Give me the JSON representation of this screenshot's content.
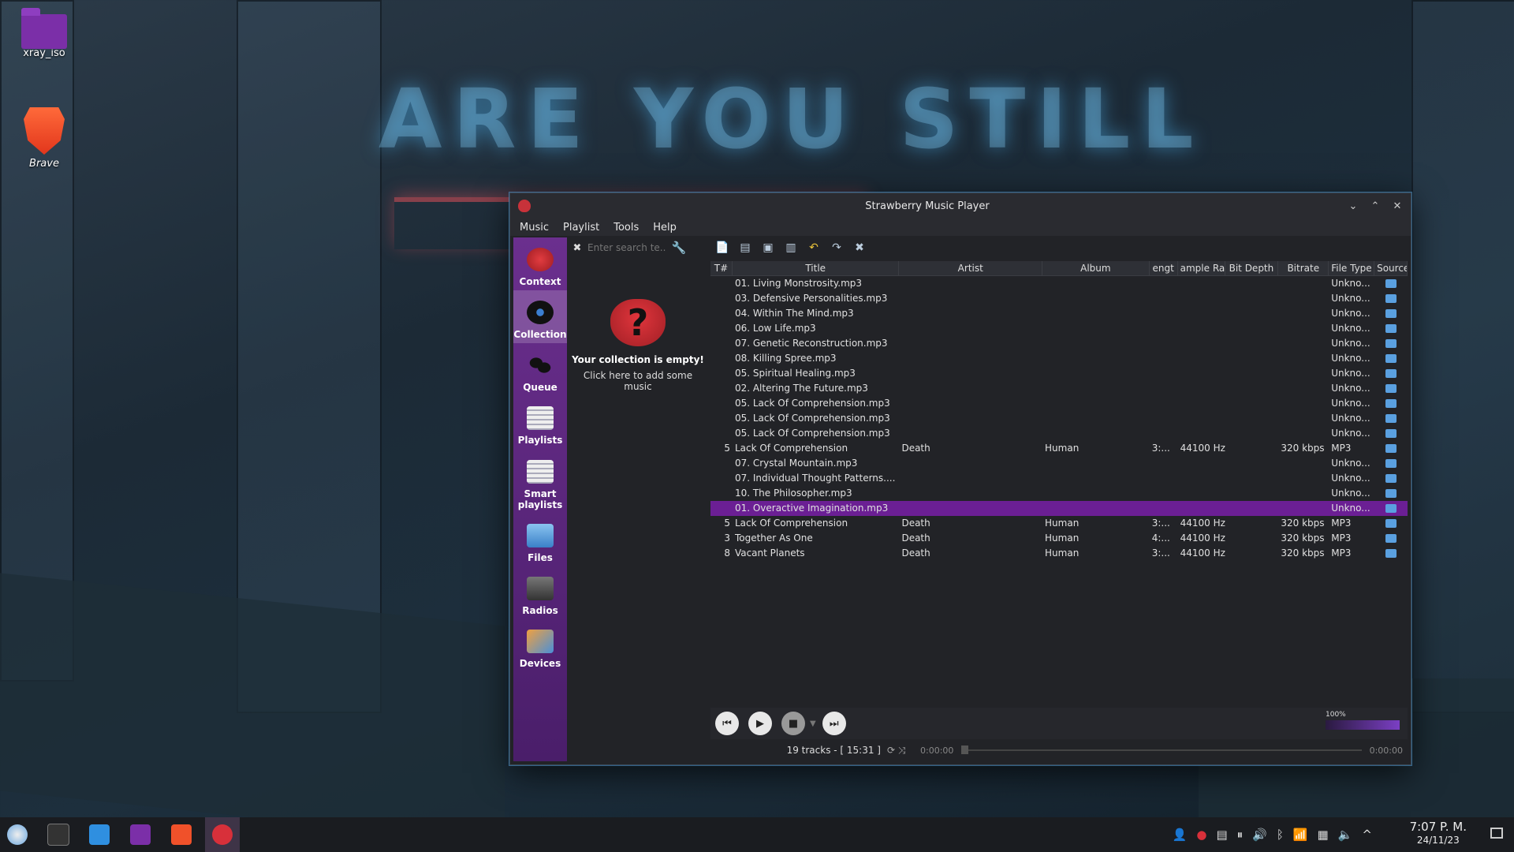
{
  "desktop": {
    "icons": [
      {
        "label": "xray_iso"
      },
      {
        "label": "Brave"
      }
    ],
    "wallpaper_text": "ARE YOU STILL"
  },
  "window": {
    "title": "Strawberry Music Player",
    "menu": [
      "Music",
      "Playlist",
      "Tools",
      "Help"
    ],
    "sidebar": [
      {
        "label": "Context",
        "icon": "strawberry-icon"
      },
      {
        "label": "Collection",
        "icon": "vinyl-icon",
        "active": true
      },
      {
        "label": "Queue",
        "icon": "footprints-icon"
      },
      {
        "label": "Playlists",
        "icon": "playlist-icon"
      },
      {
        "label": "Smart playlists",
        "icon": "smart-playlist-icon"
      },
      {
        "label": "Files",
        "icon": "files-icon"
      },
      {
        "label": "Radios",
        "icon": "radio-icon"
      },
      {
        "label": "Devices",
        "icon": "devices-icon"
      }
    ],
    "collection": {
      "search_placeholder": "Enter search te...",
      "empty_title": "Your collection is empty!",
      "empty_sub": "Click here to add some music"
    },
    "playlist": {
      "columns": [
        "T#",
        "Title",
        "Artist",
        "Album",
        "engt",
        "ample Rat",
        "Bit Depth",
        "Bitrate",
        "File Type",
        "Source"
      ],
      "rows": [
        {
          "tn": "",
          "title": "01. Living Monstrosity.mp3",
          "artist": "",
          "album": "",
          "length": "",
          "rate": "",
          "depth": "",
          "bitrate": "",
          "type": "Unkno..."
        },
        {
          "tn": "",
          "title": "03. Defensive Personalities.mp3",
          "artist": "",
          "album": "",
          "length": "",
          "rate": "",
          "depth": "",
          "bitrate": "",
          "type": "Unkno..."
        },
        {
          "tn": "",
          "title": "04. Within The Mind.mp3",
          "artist": "",
          "album": "",
          "length": "",
          "rate": "",
          "depth": "",
          "bitrate": "",
          "type": "Unkno..."
        },
        {
          "tn": "",
          "title": "06. Low Life.mp3",
          "artist": "",
          "album": "",
          "length": "",
          "rate": "",
          "depth": "",
          "bitrate": "",
          "type": "Unkno..."
        },
        {
          "tn": "",
          "title": "07. Genetic Reconstruction.mp3",
          "artist": "",
          "album": "",
          "length": "",
          "rate": "",
          "depth": "",
          "bitrate": "",
          "type": "Unkno..."
        },
        {
          "tn": "",
          "title": "08. Killing Spree.mp3",
          "artist": "",
          "album": "",
          "length": "",
          "rate": "",
          "depth": "",
          "bitrate": "",
          "type": "Unkno..."
        },
        {
          "tn": "",
          "title": "05. Spiritual Healing.mp3",
          "artist": "",
          "album": "",
          "length": "",
          "rate": "",
          "depth": "",
          "bitrate": "",
          "type": "Unkno..."
        },
        {
          "tn": "",
          "title": "02. Altering The Future.mp3",
          "artist": "",
          "album": "",
          "length": "",
          "rate": "",
          "depth": "",
          "bitrate": "",
          "type": "Unkno..."
        },
        {
          "tn": "",
          "title": "05. Lack Of Comprehension.mp3",
          "artist": "",
          "album": "",
          "length": "",
          "rate": "",
          "depth": "",
          "bitrate": "",
          "type": "Unkno..."
        },
        {
          "tn": "",
          "title": "05. Lack Of Comprehension.mp3",
          "artist": "",
          "album": "",
          "length": "",
          "rate": "",
          "depth": "",
          "bitrate": "",
          "type": "Unkno..."
        },
        {
          "tn": "",
          "title": "05. Lack Of Comprehension.mp3",
          "artist": "",
          "album": "",
          "length": "",
          "rate": "",
          "depth": "",
          "bitrate": "",
          "type": "Unkno..."
        },
        {
          "tn": "5",
          "title": "Lack Of Comprehension",
          "artist": "Death",
          "album": "Human",
          "length": "3:...",
          "rate": "44100 Hz",
          "depth": "",
          "bitrate": "320 kbps",
          "type": "MP3"
        },
        {
          "tn": "",
          "title": "07. Crystal Mountain.mp3",
          "artist": "",
          "album": "",
          "length": "",
          "rate": "",
          "depth": "",
          "bitrate": "",
          "type": "Unkno..."
        },
        {
          "tn": "",
          "title": "07. Individual Thought Patterns....",
          "artist": "",
          "album": "",
          "length": "",
          "rate": "",
          "depth": "",
          "bitrate": "",
          "type": "Unkno..."
        },
        {
          "tn": "",
          "title": "10. The Philosopher.mp3",
          "artist": "",
          "album": "",
          "length": "",
          "rate": "",
          "depth": "",
          "bitrate": "",
          "type": "Unkno..."
        },
        {
          "tn": "",
          "title": "01. Overactive Imagination.mp3",
          "artist": "",
          "album": "",
          "length": "",
          "rate": "",
          "depth": "",
          "bitrate": "",
          "type": "Unkno...",
          "selected": true
        },
        {
          "tn": "5",
          "title": "Lack Of Comprehension",
          "artist": "Death",
          "album": "Human",
          "length": "3:...",
          "rate": "44100 Hz",
          "depth": "",
          "bitrate": "320 kbps",
          "type": "MP3"
        },
        {
          "tn": "3",
          "title": "Together As One",
          "artist": "Death",
          "album": "Human",
          "length": "4:...",
          "rate": "44100 Hz",
          "depth": "",
          "bitrate": "320 kbps",
          "type": "MP3"
        },
        {
          "tn": "8",
          "title": "Vacant Planets",
          "artist": "Death",
          "album": "Human",
          "length": "3:...",
          "rate": "44100 Hz",
          "depth": "",
          "bitrate": "320 kbps",
          "type": "MP3"
        }
      ]
    },
    "volume_label": "100%",
    "volume_level": 1.0,
    "status": {
      "tracks": "19 tracks - [ 15:31 ]",
      "time_elapsed": "0:00:00",
      "time_total": "0:00:00"
    }
  },
  "taskbar": {
    "clock_time": "7:07 P. M.",
    "clock_date": "24/11/23"
  },
  "colors": {
    "selection": "#6b1f94",
    "sidebar": "#5a2880",
    "accent": "#7b3fc4"
  }
}
